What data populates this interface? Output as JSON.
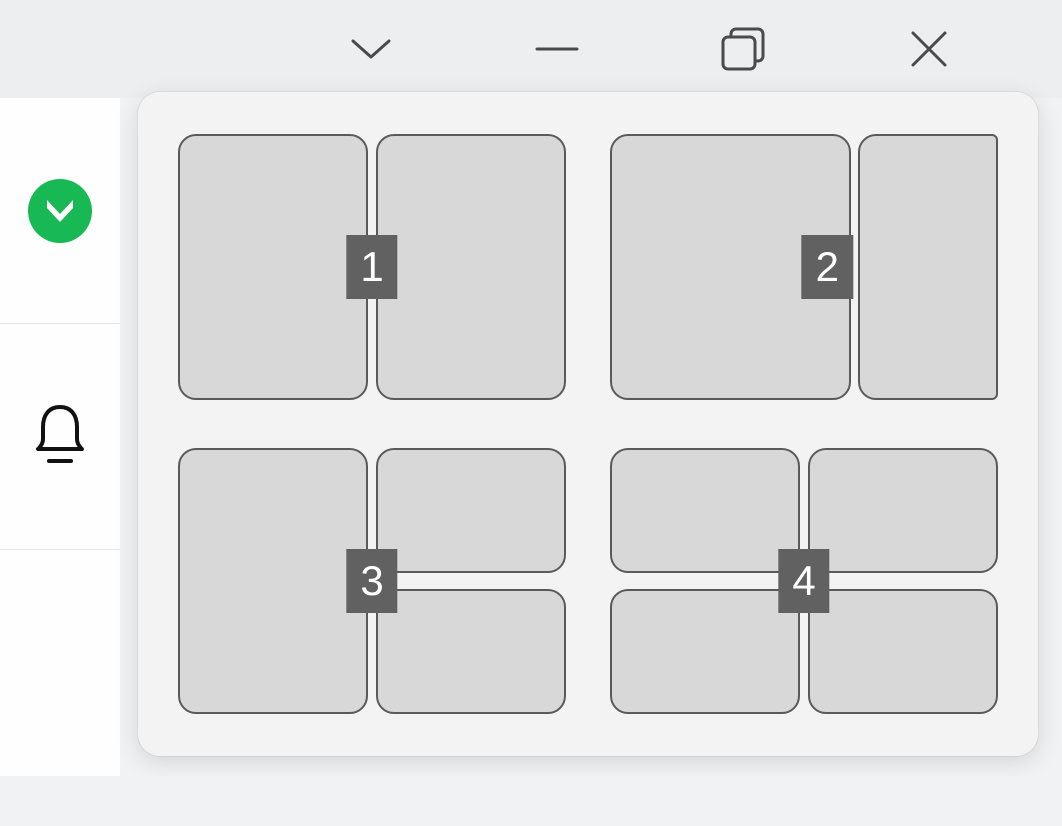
{
  "window_controls": {
    "dropdown": "chevron-down-icon",
    "minimize": "minimize-icon",
    "maximize": "maximize-restore-icon",
    "close": "close-icon"
  },
  "sidebar": {
    "items": [
      {
        "type": "app-badge",
        "name": "app-icon",
        "color": "#18b955"
      },
      {
        "type": "notifications",
        "name": "bell-icon"
      }
    ]
  },
  "snap_layouts": {
    "options": [
      {
        "id": 1,
        "label": "1",
        "zones": 2,
        "pattern": "split-2-even"
      },
      {
        "id": 2,
        "label": "2",
        "zones": 2,
        "pattern": "split-2-left-large"
      },
      {
        "id": 3,
        "label": "3",
        "zones": 3,
        "pattern": "left-full-right-stack"
      },
      {
        "id": 4,
        "label": "4",
        "zones": 4,
        "pattern": "quadrants"
      }
    ]
  }
}
